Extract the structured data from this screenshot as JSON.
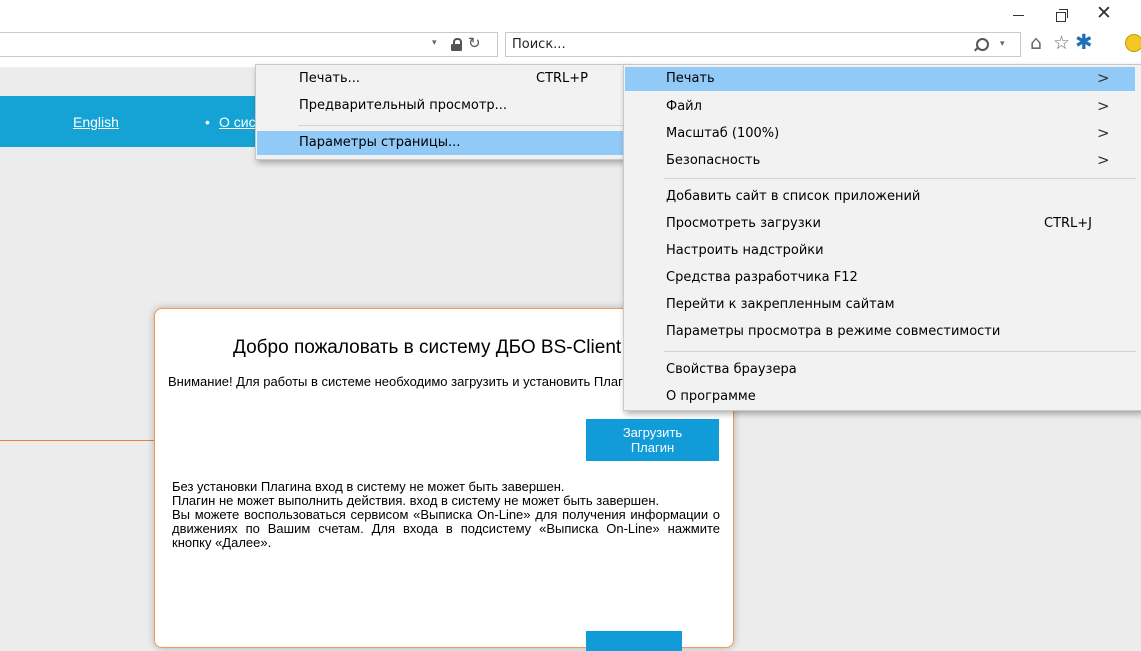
{
  "window": {
    "minimize_glyph": "",
    "close_glyph": "✕"
  },
  "address": {
    "dropdown_glyph": "▾",
    "refresh_glyph": "↻"
  },
  "search": {
    "placeholder": "Поиск...",
    "dropdown_glyph": "▾"
  },
  "toolbar_icons": {
    "home": "⌂",
    "favorites": "☆",
    "tools": "✱"
  },
  "nav": {
    "english": "English",
    "bullet": "•",
    "about": "О системе"
  },
  "dialog": {
    "title": "Добро пожаловать в систему ДБО BS-Client",
    "warning": "Внимание! Для работы в системе необходимо загрузить и установить Плагин",
    "download_button": "Загрузить\nПлагин",
    "paragraph_1": "Без установки Плагина вход в систему не может быть завершен.",
    "paragraph_2": "Плагин не может выполнить действия. вход в систему не может быть завершен.",
    "paragraph_3": "Вы можете воспользоваться сервисом «Выписка On-Line» для получения информации о движениях по Вашим счетам. Для входа в подсистему «Выписка On-Line» нажмите кнопку «Далее»."
  },
  "tools_menu": {
    "arrow_glyph": ">",
    "items": [
      {
        "label": "Печать"
      },
      {
        "label": "Файл"
      },
      {
        "label": "Масштаб (100%)"
      },
      {
        "label": "Безопасность"
      },
      {
        "label": "Добавить сайт в список приложений"
      },
      {
        "label": "Просмотреть загрузки",
        "shortcut": "CTRL+J"
      },
      {
        "label": "Настроить надстройки"
      },
      {
        "label": "Средства разработчика F12"
      },
      {
        "label": "Перейти к закрепленным сайтам"
      },
      {
        "label": "Параметры просмотра в режиме совместимости"
      },
      {
        "label": "Свойства браузера"
      },
      {
        "label": "О программе"
      }
    ]
  },
  "print_submenu": {
    "items": [
      {
        "label": "Печать...",
        "shortcut": "CTRL+P"
      },
      {
        "label": "Предварительный просмотр..."
      },
      {
        "label": "Параметры страницы..."
      }
    ]
  },
  "colors": {
    "nav_bar": "#15a3d6",
    "button": "#119bd8",
    "menu_highlight": "#91c9f7",
    "dialog_border": "#f29a4f"
  }
}
